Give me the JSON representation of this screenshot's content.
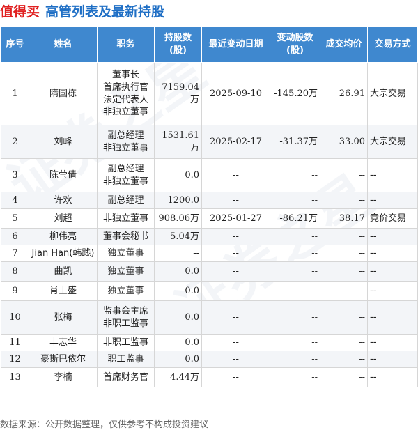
{
  "header": {
    "brand": "值得买",
    "title": "高管列表及最新持股"
  },
  "table": {
    "columns": [
      "序号",
      "姓名",
      "职务",
      "持股数\n(股)",
      "最近变动日期",
      "变动股数\n(股)",
      "成交均价",
      "交易方式"
    ],
    "rows": [
      {
        "idx": "1",
        "name": "隋国栋",
        "role": "董事长\n首席执行官\n法定代表人\n非独立董事",
        "hold": "7159.04万",
        "date": "2025-09-10",
        "chg": "-145.20万",
        "price": "26.91",
        "type": "大宗交易"
      },
      {
        "idx": "2",
        "name": "刘峰",
        "role": "副总经理\n非独立董事",
        "hold": "1531.61万",
        "date": "2025-02-17",
        "chg": "-31.37万",
        "price": "33.00",
        "type": "大宗交易"
      },
      {
        "idx": "3",
        "name": "陈莹倩",
        "role": "副总经理\n非独立董事",
        "hold": "0.0",
        "date": "--",
        "chg": "--",
        "price": "--",
        "type": "--"
      },
      {
        "idx": "4",
        "name": "许欢",
        "role": "副总经理",
        "hold": "1200.0",
        "date": "--",
        "chg": "--",
        "price": "--",
        "type": "--"
      },
      {
        "idx": "5",
        "name": "刘超",
        "role": "非独立董事",
        "hold": "908.06万",
        "date": "2025-01-27",
        "chg": "-86.21万",
        "price": "38.17",
        "type": "竞价交易"
      },
      {
        "idx": "6",
        "name": "柳伟亮",
        "role": "董事会秘书",
        "hold": "5.04万",
        "date": "--",
        "chg": "--",
        "price": "--",
        "type": "--"
      },
      {
        "idx": "7",
        "name": "Jian Han(韩践)",
        "role": "独立董事",
        "hold": "--",
        "date": "--",
        "chg": "--",
        "price": "--",
        "type": "--"
      },
      {
        "idx": "8",
        "name": "曲凯",
        "role": "独立董事",
        "hold": "0.0",
        "date": "--",
        "chg": "--",
        "price": "--",
        "type": "--"
      },
      {
        "idx": "9",
        "name": "肖土盛",
        "role": "独立董事",
        "hold": "0.0",
        "date": "--",
        "chg": "--",
        "price": "--",
        "type": "--"
      },
      {
        "idx": "10",
        "name": "张梅",
        "role": "监事会主席\n非职工监事",
        "hold": "0.0",
        "date": "--",
        "chg": "--",
        "price": "--",
        "type": "--"
      },
      {
        "idx": "11",
        "name": "丰志华",
        "role": "非职工监事",
        "hold": "0.0",
        "date": "--",
        "chg": "--",
        "price": "--",
        "type": "--"
      },
      {
        "idx": "12",
        "name": "豪斯巴依尔",
        "role": "职工监事",
        "hold": "0.0",
        "date": "--",
        "chg": "--",
        "price": "--",
        "type": "--"
      },
      {
        "idx": "13",
        "name": "李楠",
        "role": "首席财务官",
        "hold": "4.44万",
        "date": "--",
        "chg": "--",
        "price": "--",
        "type": "--"
      }
    ]
  },
  "footer": {
    "source": "数据来源：公开数据整理，仅供参考不构成投资建议"
  },
  "colors": {
    "brand": "#e02020",
    "title": "#1f6fc5",
    "header_bg": "#3f88cf",
    "change_green": "#1a9a3a"
  }
}
